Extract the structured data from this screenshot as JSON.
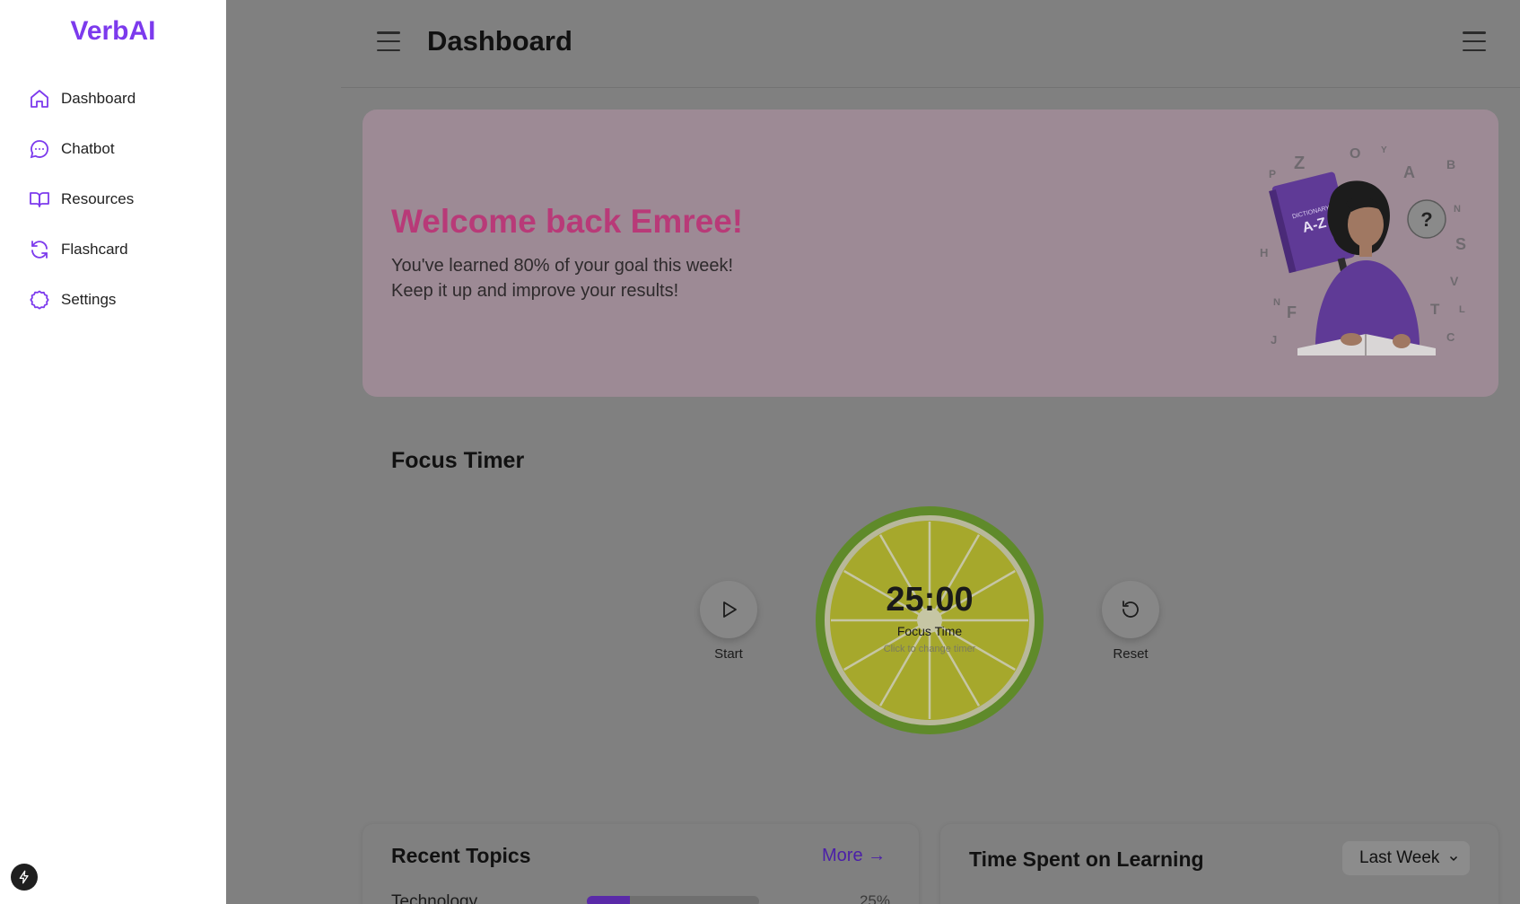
{
  "app": {
    "name": "VerbAI"
  },
  "sidebar": {
    "items": [
      {
        "label": "Dashboard",
        "icon": "home-icon"
      },
      {
        "label": "Chatbot",
        "icon": "chat-icon"
      },
      {
        "label": "Resources",
        "icon": "book-icon"
      },
      {
        "label": "Flashcard",
        "icon": "refresh-icon"
      },
      {
        "label": "Settings",
        "icon": "gear-icon"
      }
    ]
  },
  "header": {
    "title": "Dashboard"
  },
  "welcome": {
    "title": "Welcome back Emree!",
    "line1": "You've learned 80% of your goal this week!",
    "line2": "Keep it up and improve your results!"
  },
  "focus_timer": {
    "title": "Focus Timer",
    "time": "25:00",
    "label": "Focus Time",
    "hint": "Click to change timer",
    "start_label": "Start",
    "reset_label": "Reset"
  },
  "recent_topics": {
    "title": "Recent Topics",
    "more_label": "More →",
    "items": [
      {
        "name": "Technology",
        "percent": "25%",
        "progress": 0.25
      }
    ]
  },
  "time_spent": {
    "title": "Time Spent on Learning",
    "range_selected": "Last Week"
  },
  "colors": {
    "accent": "#7c3aed",
    "welcome_title": "#b83a78",
    "lime_ring": "#5f8a2a",
    "lime_flesh": "#a6a82c"
  }
}
